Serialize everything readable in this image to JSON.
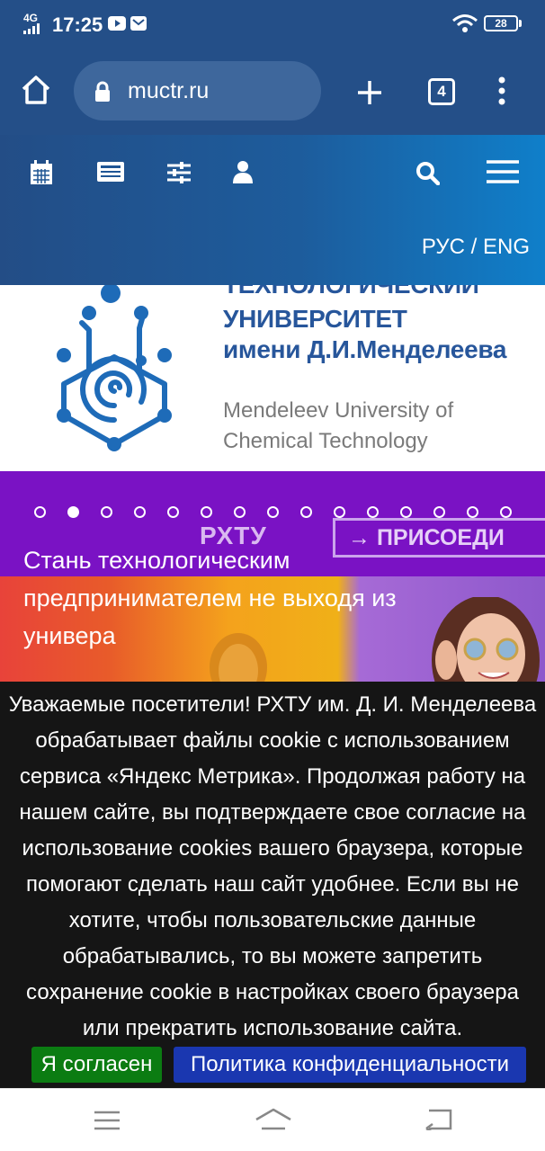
{
  "status_bar": {
    "network": "4G",
    "time": "17:25",
    "battery": "28",
    "icons": [
      "signal-icon",
      "youtube-icon",
      "mail-icon",
      "wifi-icon",
      "battery-icon"
    ]
  },
  "browser": {
    "url": "muctr.ru",
    "tab_count": "4",
    "icons": [
      "home-icon",
      "lock-icon",
      "plus-icon",
      "tabs-icon",
      "more-icon"
    ]
  },
  "site_header": {
    "language": "РУС / ENG",
    "icons": [
      "calendar-icon",
      "news-icon",
      "sliders-icon",
      "user-icon",
      "search-icon",
      "hamburger-icon"
    ]
  },
  "logo": {
    "line1": "ТЕХНОЛОГИЧЕСКИЙ",
    "line2": "УНИВЕРСИТЕТ",
    "line3": "имени Д.И.Менделеева",
    "en_line1": "Mendeleev University of",
    "en_line2": "Chemical Technology"
  },
  "banner": {
    "slide_count": 15,
    "active_slide": 2,
    "logo_text": "РХТУ",
    "join_text": "→ ПРИСОЕДИ",
    "headline": [
      "Стань технологическим",
      "предпринимателем не выходя из",
      "универа"
    ]
  },
  "cookie": {
    "lines": [
      "Уважаемые посетители! РХТУ им. Д. И. Менделеева",
      "обрабатывает файлы cookie с использованием",
      "сервиса «Яндекс Метрика». Продолжая работу на",
      "нашем сайте, вы подтверждаете свое согласие на",
      "использование cookies вашего браузера, которые",
      "помогают сделать наш сайт удобнее. Если вы не",
      "хотите, чтобы пользовательские данные",
      "обрабатывались, то вы можете запретить",
      "сохранение cookie в настройках своего браузера",
      "или прекратить использование сайта."
    ],
    "agree_label": "Я согласен",
    "policy_label": "Политика конфиденциальности"
  },
  "colors": {
    "header_blue": "#244f88",
    "brand_blue": "#27569b",
    "banner_purple": "#7a12c4",
    "agree_green": "#0b7c12",
    "policy_blue": "#1a37b0"
  }
}
